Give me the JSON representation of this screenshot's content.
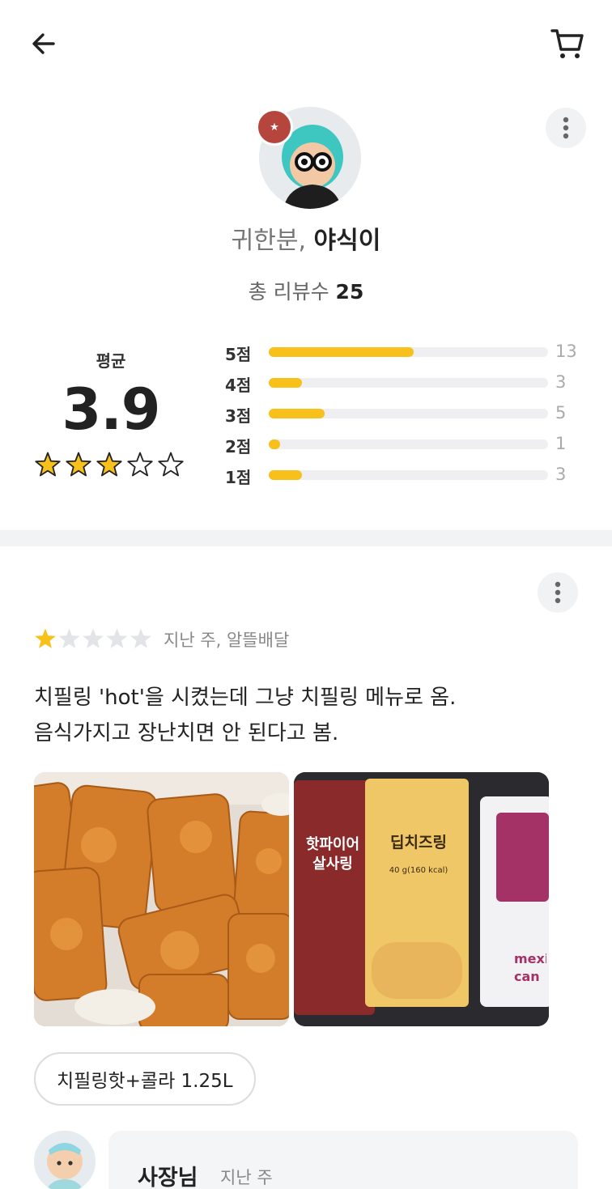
{
  "header": {
    "back_icon": "arrow-left-icon",
    "cart_icon": "cart-icon"
  },
  "profile": {
    "nickname_prefix": "귀한분,",
    "nickname": "야식이",
    "total_reviews_label": "총 리뷰수",
    "total_reviews_count": "25",
    "average_label": "평균",
    "average_value": "3.9",
    "average_rating": 3.9,
    "distribution": [
      {
        "label": "5점",
        "count": "13",
        "value": 13
      },
      {
        "label": "4점",
        "count": "3",
        "value": 3
      },
      {
        "label": "3점",
        "count": "5",
        "value": 5
      },
      {
        "label": "2점",
        "count": "1",
        "value": 1
      },
      {
        "label": "1점",
        "count": "3",
        "value": 3
      }
    ]
  },
  "review": {
    "rating": 1,
    "date": "지난 주, 알뜰배달",
    "text_line1": "치필링 'hot'을 시켰는데 그냥 치필링 메뉴로 옴.",
    "text_line2": "음식가지고 장난치면 안 된다고 봄.",
    "menu_tag": "치필링핫+콜라 1.25L",
    "photo_labels": {
      "sauce_left": "핫파이어 살사링",
      "sauce_center": "딥치즈링",
      "sauce_center_weight": "40 g(160 kcal)",
      "sauce_right_brand": "mexi can"
    }
  },
  "reply": {
    "author": "사장님",
    "date": "지난 주"
  },
  "colors": {
    "accent_yellow": "#f7c01b",
    "track_gray": "#efeff1",
    "divider_gray": "#f2f3f5"
  }
}
